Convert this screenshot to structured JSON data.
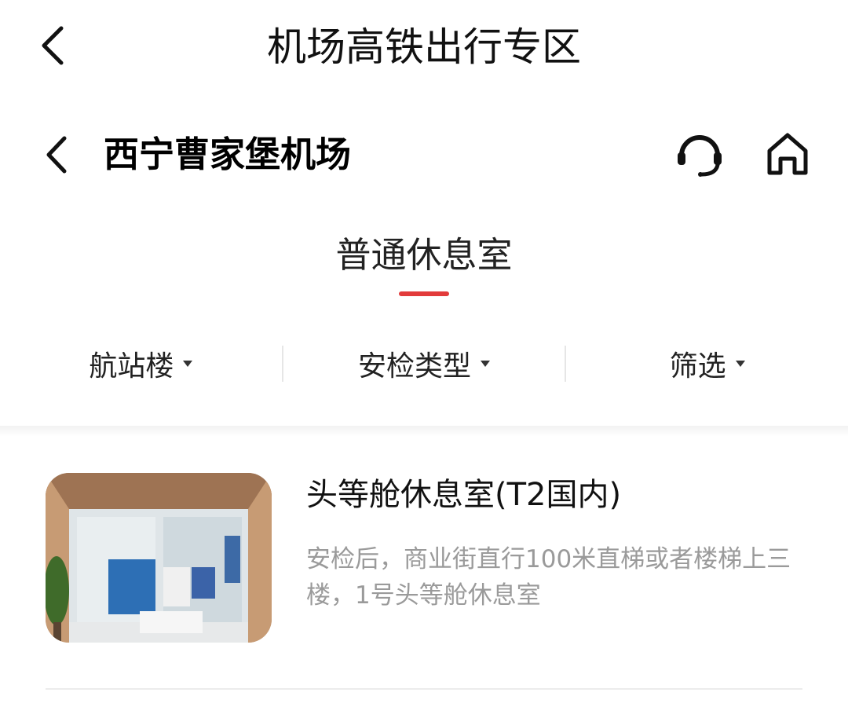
{
  "header": {
    "title": "机场高铁出行专区"
  },
  "subheader": {
    "airport_name": "西宁曹家堡机场"
  },
  "tab": {
    "label": "普通休息室",
    "accent_color": "#e23b3b"
  },
  "filters": [
    {
      "label": "航站楼"
    },
    {
      "label": "安检类型"
    },
    {
      "label": "筛选"
    }
  ],
  "lounge": {
    "title": "头等舱休息室(T2国内)",
    "description": "安检后，商业街直行100米直梯或者楼梯上三楼，1号头等舱休息室"
  }
}
